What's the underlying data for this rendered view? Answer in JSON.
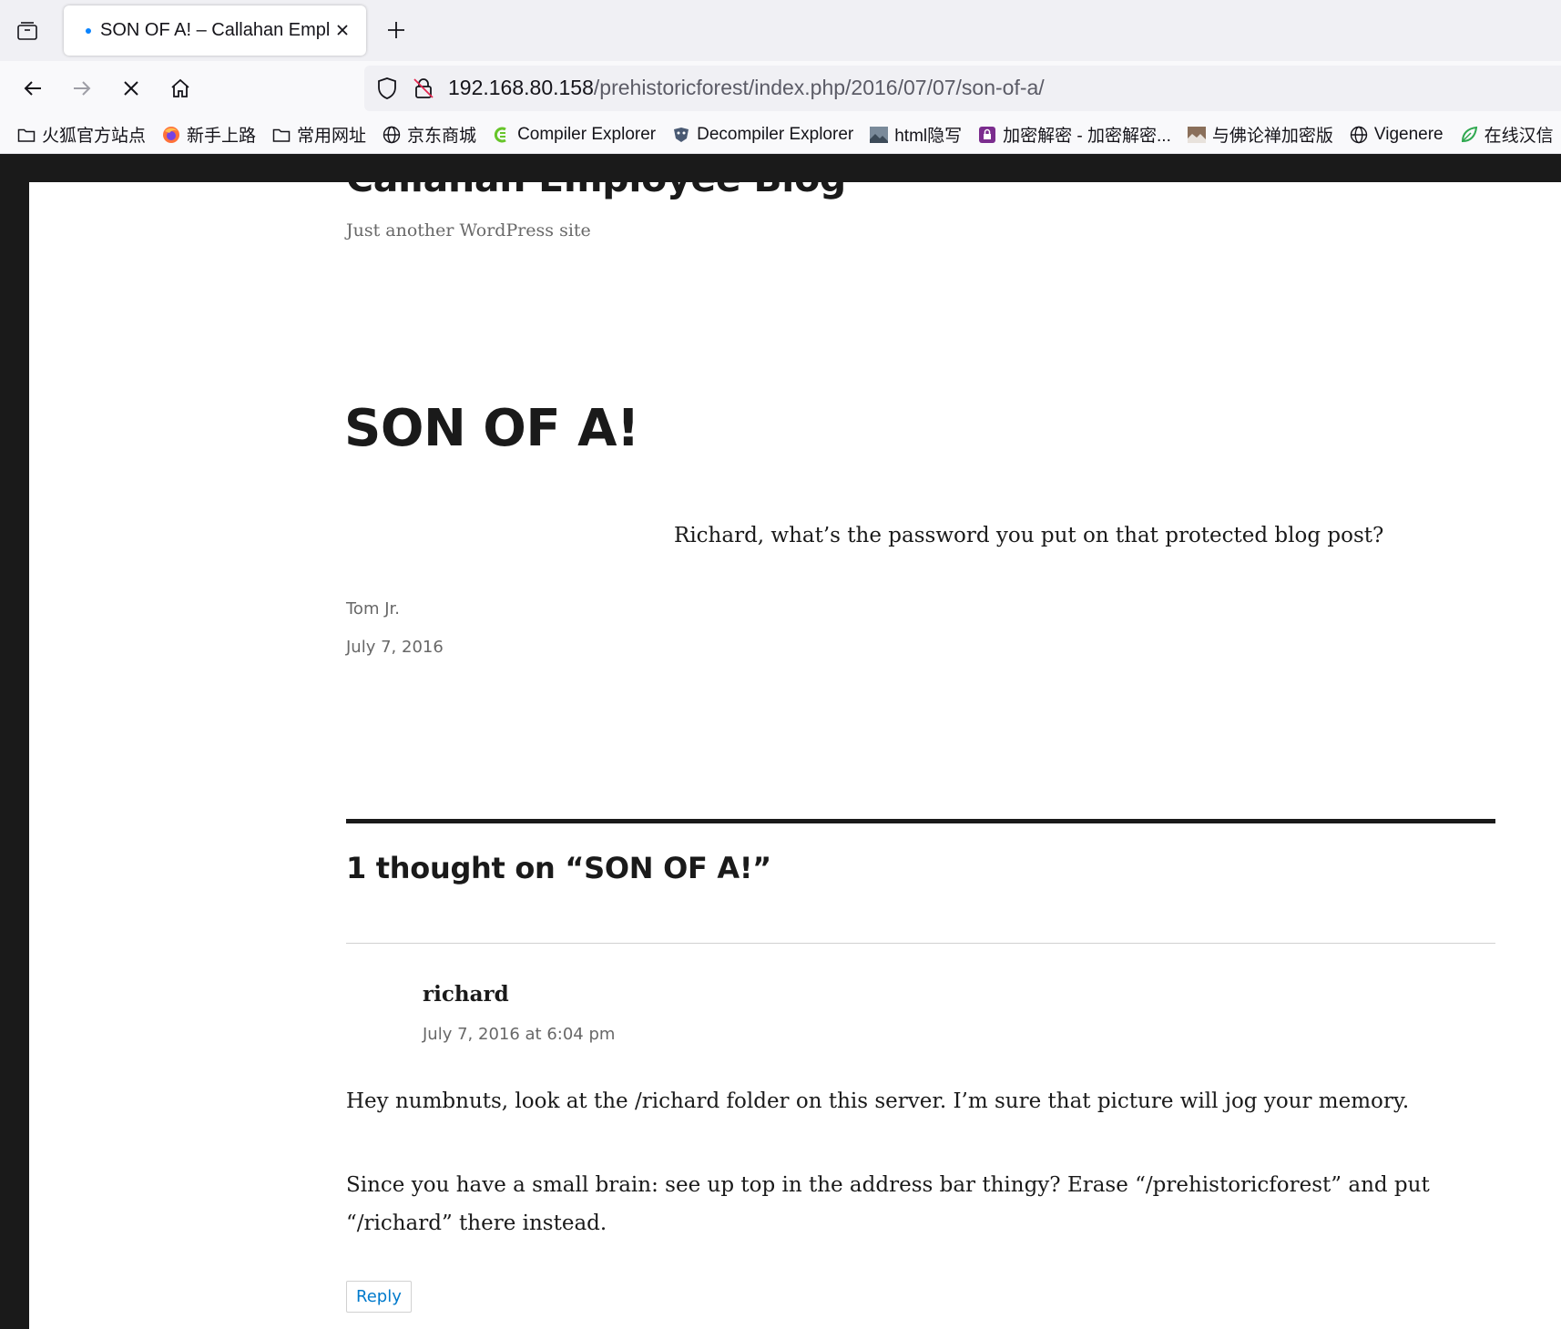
{
  "browser": {
    "tab": {
      "title": "SON OF A! – Callahan Employee Blog"
    },
    "url": {
      "host": "192.168.80.158",
      "path": "/prehistoricforest/index.php/2016/07/07/son-of-a/"
    },
    "bookmarks": [
      {
        "label": "火狐官方站点",
        "icon": "folder-icon"
      },
      {
        "label": "新手上路",
        "icon": "firefox-icon"
      },
      {
        "label": "常用网址",
        "icon": "folder-icon"
      },
      {
        "label": "京东商城",
        "icon": "globe-icon"
      },
      {
        "label": "Compiler Explorer",
        "icon": "compiler-explorer-icon"
      },
      {
        "label": "Decompiler Explorer",
        "icon": "decompiler-icon"
      },
      {
        "label": "html隐写",
        "icon": "image-icon"
      },
      {
        "label": "加密解密 - 加密解密...",
        "icon": "crypto-icon"
      },
      {
        "label": "与佛论禅加密版",
        "icon": "image-icon"
      },
      {
        "label": "Vigenere",
        "icon": "globe-icon"
      },
      {
        "label": "在线汉信",
        "icon": "leaf-icon"
      }
    ]
  },
  "site": {
    "title": "Callahan Employee Blog",
    "description": "Just another WordPress site"
  },
  "post": {
    "title": "SON OF A!",
    "body": "Richard, what’s the password you put on that protected blog post?",
    "author": "Tom Jr.",
    "date": "July 7, 2016"
  },
  "comments": {
    "title": "1 thought on “SON OF A!”",
    "items": [
      {
        "author": "richard",
        "date": "July 7, 2016 at 6:04 pm",
        "paragraphs": [
          "Hey numbnuts, look at the /richard folder on this server. I’m sure that picture will jog your memory.",
          "Since you have a small brain: see up top in the address bar thingy? Erase “/prehistoricforest” and put “/richard” there instead."
        ],
        "reply_label": "Reply"
      }
    ]
  }
}
